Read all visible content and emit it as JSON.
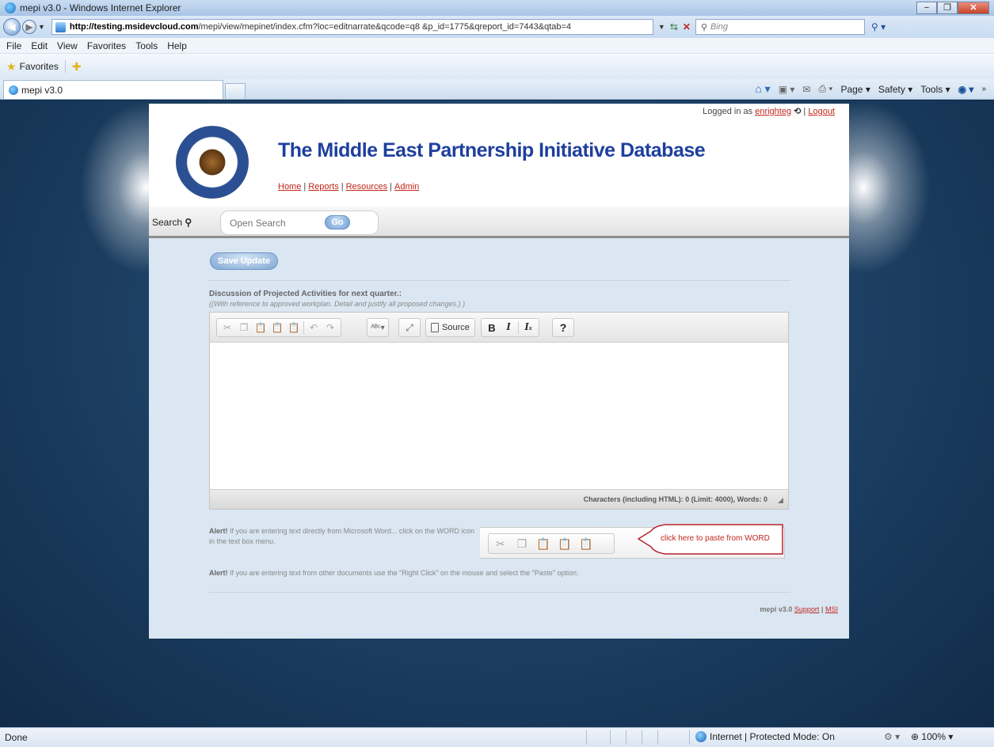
{
  "window": {
    "title": "mepi v3.0 - Windows Internet Explorer",
    "minimize": "−",
    "maximize": "❐",
    "close": "✕"
  },
  "address": {
    "url_host": "http://testing.msidevcloud.com",
    "url_path": "/mepi/view/mepinet/index.cfm?loc=editnarrate&qcode=q8     &p_id=1775&qreport_id=7443&qtab=4",
    "search_placeholder": "Bing"
  },
  "menu": [
    "File",
    "Edit",
    "View",
    "Favorites",
    "Tools",
    "Help"
  ],
  "favorites_label": "Favorites",
  "tab": {
    "label": "mepi v3.0"
  },
  "command_bar": [
    "Page ▾",
    "Safety ▾",
    "Tools ▾"
  ],
  "header": {
    "logged_in_prefix": "Logged in as",
    "username": "enrighteg",
    "logout": "Logout",
    "separator": "|",
    "site_title": "The Middle East Partnership Initiative Database",
    "nav": [
      "Home",
      "Reports",
      "Resources",
      "Admin"
    ]
  },
  "search": {
    "label": "Search",
    "placeholder": "Open Search",
    "go": "Go"
  },
  "form": {
    "save_button": "Save Update",
    "field_label": "Discussion of Projected Activities for next quarter.:",
    "field_hint": "((With reference to approved workplan. Detail and justify all proposed changes.) )",
    "source_label": "Source",
    "counter": "Characters (including HTML): 0 (Limit: 4000), Words: 0"
  },
  "alerts": {
    "alert_word_bold": "Alert!",
    "alert_word_text": " If you are entering text directly from Microsoft Word... click on the WORD icon in the text box menu.",
    "callout": "click here to paste from WORD",
    "alert_other_bold": "Alert!",
    "alert_other_text": " If you are entering text from other documents use the \"Right Click\" on the mouse and select the \"Paste\" option."
  },
  "footer": {
    "version": "mepi v3.0",
    "support": "Support",
    "separator": "|",
    "msi": "MSI"
  },
  "status": {
    "done": "Done",
    "zone": "Internet | Protected Mode: On",
    "zoom": "100%"
  }
}
